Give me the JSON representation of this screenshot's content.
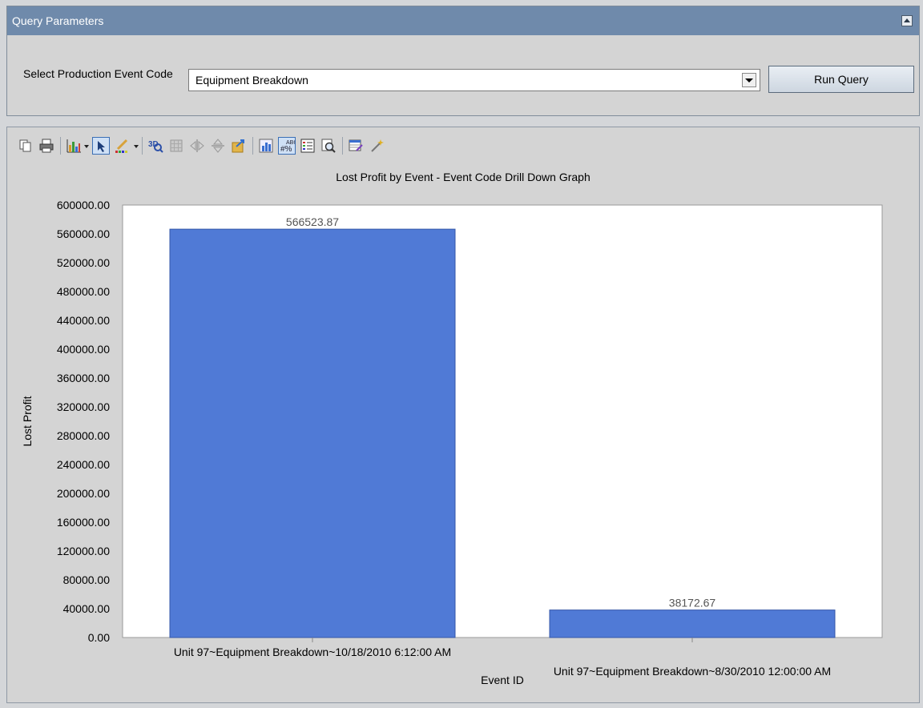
{
  "query_panel": {
    "title": "Query Parameters",
    "event_code_label": "Select Production Event Code",
    "event_code_value": "Equipment Breakdown",
    "run_button_label": "Run Query"
  },
  "toolbar": {
    "icons": [
      "copy-icon",
      "print-icon",
      "chart-type-icon",
      "select-mode-icon",
      "palette-icon",
      "3d-icon",
      "grid-icon",
      "rotate-horizontal-icon",
      "rotate-vertical-icon",
      "export-icon",
      "axis-settings-icon",
      "data-labels-icon",
      "legend-icon",
      "zoom-icon",
      "data-editor-icon",
      "wizard-icon"
    ]
  },
  "colors": {
    "header_bg": "#6f8aab",
    "bar": "#507ad6",
    "panel_bg": "#d4d4d4"
  },
  "chart_data": {
    "type": "bar",
    "title": "Lost Profit by Event - Event Code Drill Down Graph",
    "xlabel": "Event ID",
    "ylabel": "Lost Profit",
    "categories": [
      "Unit 97~Equipment Breakdown~10/18/2010 6:12:00 AM",
      "Unit 97~Equipment Breakdown~8/30/2010 12:00:00 AM"
    ],
    "values": [
      566523.87,
      38172.67
    ],
    "value_labels": [
      "566523.87",
      "38172.67"
    ],
    "ylim": [
      0,
      600000
    ],
    "ytick_step": 40000,
    "ytick_labels": [
      "0.00",
      "40000.00",
      "80000.00",
      "120000.00",
      "160000.00",
      "200000.00",
      "240000.00",
      "280000.00",
      "320000.00",
      "360000.00",
      "400000.00",
      "440000.00",
      "480000.00",
      "520000.00",
      "560000.00",
      "600000.00"
    ],
    "grid": false,
    "legend": "none"
  }
}
